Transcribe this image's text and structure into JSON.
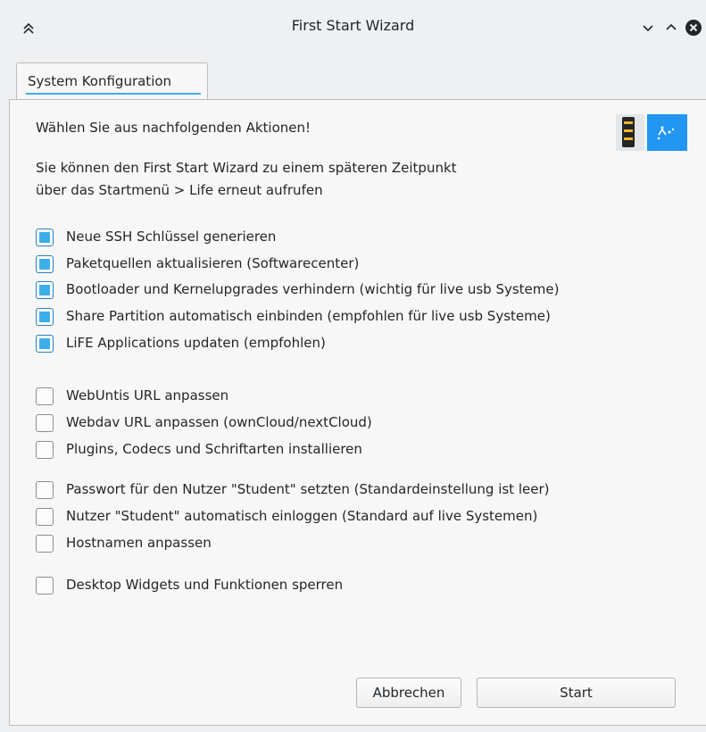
{
  "window": {
    "title": "First Start Wizard"
  },
  "tabs": [
    {
      "label": "System Konfiguration",
      "active": true
    }
  ],
  "content": {
    "intro": "Wählen Sie aus nachfolgenden Aktionen!",
    "note_line1": "Sie können den First Start Wizard zu einem späteren Zeitpunkt",
    "note_line2": "über das Startmenü > Life erneut aufrufen"
  },
  "options": [
    {
      "label": "Neue SSH Schlüssel generieren",
      "checked": true
    },
    {
      "label": "Paketquellen aktualisieren (Softwarecenter)",
      "checked": true
    },
    {
      "label": "Bootloader und Kernelupgrades verhindern (wichtig für live usb Systeme)",
      "checked": true
    },
    {
      "label": "Share Partition automatisch einbinden (empfohlen für live usb Systeme)",
      "checked": true
    },
    {
      "label": "LiFE Applications updaten (empfohlen)",
      "checked": true
    },
    {
      "label": "WebUntis URL anpassen",
      "checked": false
    },
    {
      "label": "Webdav URL anpassen (ownCloud/nextCloud)",
      "checked": false
    },
    {
      "label": "Plugins, Codecs und Schriftarten installieren",
      "checked": false
    },
    {
      "label": "Passwort für den Nutzer \"Student\" setzten (Standardeinstellung ist leer)",
      "checked": false
    },
    {
      "label": "Nutzer \"Student\" automatisch einloggen (Standard auf live Systemen)",
      "checked": false
    },
    {
      "label": "Hostnamen anpassen",
      "checked": false
    },
    {
      "label": "Desktop Widgets und Funktionen sperren",
      "checked": false
    }
  ],
  "buttons": {
    "cancel": "Abbrechen",
    "start": "Start"
  },
  "icons": {
    "keep_above": "chevrons-up-icon",
    "minimize": "chevron-down-icon",
    "maximize": "chevron-up-icon",
    "close": "close-icon",
    "logo": "life-usb-logo"
  },
  "colors": {
    "accent": "#3daee9",
    "window_bg": "#eff0f1",
    "panel_bg": "#f7f7f7"
  }
}
